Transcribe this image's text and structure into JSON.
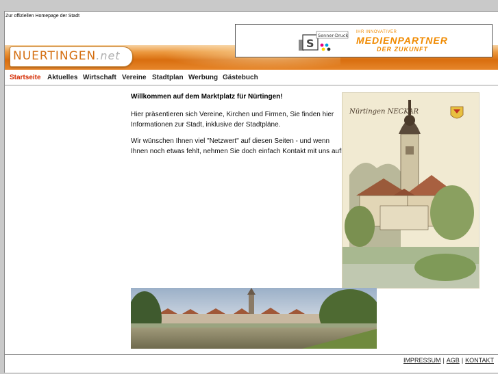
{
  "header": {
    "official_link": "Zur offiziellen Homepage der Stadt",
    "logo_main": "NUERTINGEN",
    "logo_tld": ".net"
  },
  "ad": {
    "brand": "Senner-Druck",
    "line1": "IHR INNOVATIVER",
    "line2": "MEDIENPARTNER",
    "line3": "DER ZUKUNFT"
  },
  "nav": {
    "items": [
      "Startseite",
      "Aktuelles",
      "Wirtschaft",
      "Vereine",
      "Stadtplan",
      "Werbung",
      "Gästebuch"
    ],
    "active": "Startseite"
  },
  "main": {
    "title": "Willkommen auf dem Marktplatz für Nürtingen!",
    "para1": "Hier präsentieren sich Vereine, Kirchen und Firmen, Sie finden hier Informationen zur Stadt, inklusive der Stadtpläne.",
    "para2": "Wir wünschen Ihnen viel \"Netzwert\" auf diesen Seiten - und wenn Ihnen noch etwas fehlt, nehmen Sie doch einfach Kontakt mit uns auf!"
  },
  "postcard": {
    "caption": "Nürtingen NECKAR"
  },
  "footer": {
    "impressum": "IMPRESSUM",
    "agb": "AGB",
    "kontakt": "KONTAKT",
    "separator": "|"
  },
  "colors": {
    "brand_orange": "#d46e10",
    "nav_active": "#d42a00",
    "ad_orange": "#f08a00"
  }
}
